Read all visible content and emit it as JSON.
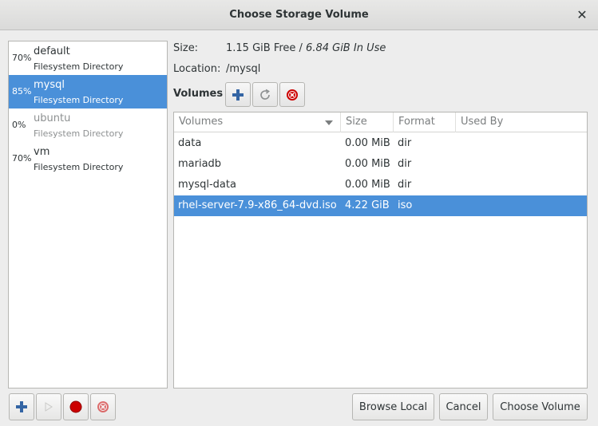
{
  "window": {
    "title": "Choose Storage Volume"
  },
  "pools": [
    {
      "percent": "70%",
      "name": "default",
      "type": "Filesystem Directory"
    },
    {
      "percent": "85%",
      "name": "mysql",
      "type": "Filesystem Directory"
    },
    {
      "percent": "0%",
      "name": "ubuntu",
      "type": "Filesystem Directory"
    },
    {
      "percent": "70%",
      "name": "vm",
      "type": "Filesystem Directory"
    }
  ],
  "details": {
    "size_label": "Size:",
    "size_free": "1.15 GiB Free / ",
    "size_inuse": "6.84 GiB In Use",
    "location_label": "Location:",
    "location_value": "/mysql",
    "volumes_label": "Volumes"
  },
  "table": {
    "columns": [
      "Volumes",
      "Size",
      "Format",
      "Used By"
    ],
    "rows": [
      {
        "name": "data",
        "size": "0.00 MiB",
        "format": "dir",
        "used_by": ""
      },
      {
        "name": "mariadb",
        "size": "0.00 MiB",
        "format": "dir",
        "used_by": ""
      },
      {
        "name": "mysql-data",
        "size": "0.00 MiB",
        "format": "dir",
        "used_by": ""
      },
      {
        "name": "rhel-server-7.9-x86_64-dvd.iso",
        "size": "4.22 GiB",
        "format": "iso",
        "used_by": ""
      }
    ]
  },
  "buttons": {
    "browse_local": "Browse Local",
    "cancel": "Cancel",
    "choose_volume": "Choose Volume"
  },
  "icons": {
    "add": "plus-icon",
    "refresh": "refresh-icon",
    "delete": "delete-icon",
    "start": "play-icon",
    "stop": "stop-icon"
  },
  "colors": {
    "accent": "#4a90d9",
    "add_blue": "#3465a4",
    "stop_red": "#cc0000"
  }
}
